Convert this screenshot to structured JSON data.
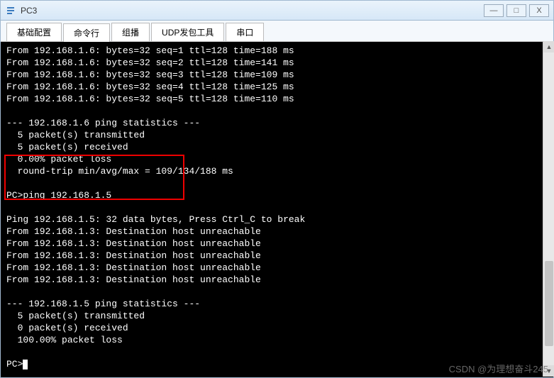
{
  "window": {
    "title": "PC3",
    "icon": "app-icon"
  },
  "tabs": [
    {
      "label": "基础配置",
      "active": false
    },
    {
      "label": "命令行",
      "active": true
    },
    {
      "label": "组播",
      "active": false
    },
    {
      "label": "UDP发包工具",
      "active": false
    },
    {
      "label": "串口",
      "active": false
    }
  ],
  "terminal": {
    "lines": [
      "From 192.168.1.6: bytes=32 seq=1 ttl=128 time=188 ms",
      "From 192.168.1.6: bytes=32 seq=2 ttl=128 time=141 ms",
      "From 192.168.1.6: bytes=32 seq=3 ttl=128 time=109 ms",
      "From 192.168.1.6: bytes=32 seq=4 ttl=128 time=125 ms",
      "From 192.168.1.6: bytes=32 seq=5 ttl=128 time=110 ms",
      "",
      "--- 192.168.1.6 ping statistics ---",
      "  5 packet(s) transmitted",
      "  5 packet(s) received",
      "  0.00% packet loss",
      "  round-trip min/avg/max = 109/134/188 ms",
      "",
      "PC>ping 192.168.1.5",
      "",
      "Ping 192.168.1.5: 32 data bytes, Press Ctrl_C to break",
      "From 192.168.1.3: Destination host unreachable",
      "From 192.168.1.3: Destination host unreachable",
      "From 192.168.1.3: Destination host unreachable",
      "From 192.168.1.3: Destination host unreachable",
      "From 192.168.1.3: Destination host unreachable",
      "",
      "--- 192.168.1.5 ping statistics ---",
      "  5 packet(s) transmitted",
      "  0 packet(s) received",
      "  100.00% packet loss",
      "",
      "PC>"
    ],
    "prompt": "PC>"
  },
  "watermark": "CSDN @为理想奋斗245",
  "controls": {
    "minimize": "—",
    "maximize": "□",
    "close": "X"
  }
}
